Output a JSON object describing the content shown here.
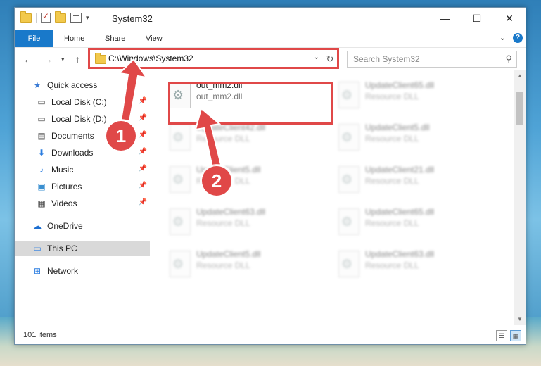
{
  "window": {
    "title": "System32",
    "controls": {
      "minimize": "—",
      "maximize": "☐",
      "close": "✕"
    }
  },
  "ribbon": {
    "tabs": [
      "File",
      "Home",
      "Share",
      "View"
    ],
    "help": "?"
  },
  "address": {
    "path": "C:\\Windows\\System32",
    "search_placeholder": "Search System32"
  },
  "nav": {
    "quick_access": "Quick access",
    "pinned": [
      {
        "label": "Local Disk (C:)",
        "icon": "drive-icon"
      },
      {
        "label": "Local Disk (D:)",
        "icon": "drive-icon"
      },
      {
        "label": "Documents",
        "icon": "documents-icon"
      },
      {
        "label": "Downloads",
        "icon": "downloads-icon"
      },
      {
        "label": "Music",
        "icon": "music-icon"
      },
      {
        "label": "Pictures",
        "icon": "pictures-icon"
      },
      {
        "label": "Videos",
        "icon": "videos-icon"
      }
    ],
    "onedrive": "OneDrive",
    "this_pc": "This PC",
    "network": "Network"
  },
  "files": [
    {
      "name": "out_mm2.dll",
      "type": "out_mm2.dll"
    },
    {
      "name": "UpdateClient65.dll",
      "type": "Resource DLL"
    },
    {
      "name": "UpdateClient42.dll",
      "type": "Resource DLL"
    },
    {
      "name": "UpdateClient5.dll",
      "type": "Resource DLL"
    },
    {
      "name": "UpdateClient5.dll",
      "type": "Resource DLL"
    },
    {
      "name": "UpdateClient21.dll",
      "type": "Resource DLL"
    },
    {
      "name": "UpdateClient63.dll",
      "type": "Resource DLL"
    },
    {
      "name": "UpdateClient65.dll",
      "type": "Resource DLL"
    },
    {
      "name": "UpdateClient5.dll",
      "type": "Resource DLL"
    },
    {
      "name": "UpdateClient63.dll",
      "type": "Resource DLL"
    }
  ],
  "status": {
    "count": "101 items"
  },
  "annotations": {
    "step1": "1",
    "step2": "2",
    "color": "#e04848"
  }
}
